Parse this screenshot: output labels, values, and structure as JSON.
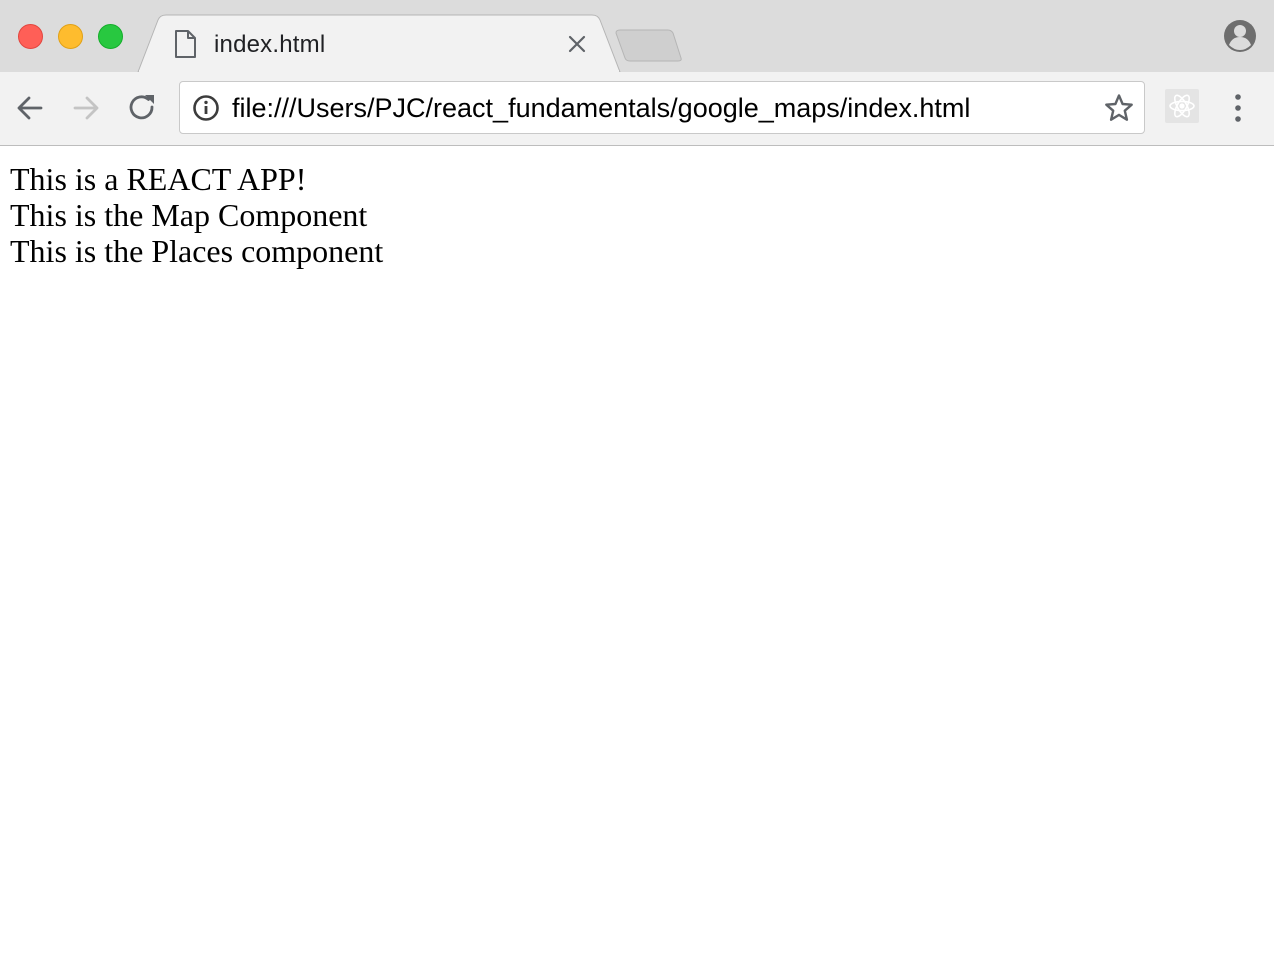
{
  "window": {
    "controls": [
      "close",
      "minimize",
      "maximize"
    ]
  },
  "tabs": [
    {
      "title": "index.html",
      "icon": "document-icon",
      "active": true
    }
  ],
  "toolbar": {
    "url": "file:///Users/PJC/react_fundamentals/google_maps/index.html",
    "icons": [
      "back-arrow-icon",
      "forward-arrow-icon",
      "reload-icon",
      "info-icon",
      "star-icon",
      "react-devtools-icon",
      "more-vert-icon",
      "profile-icon"
    ]
  },
  "page": {
    "lines": [
      "This is a REACT APP!",
      "This is the Map Component",
      "This is the Places component"
    ]
  },
  "colors": {
    "close": "#ff5f57",
    "minimize": "#febc2e",
    "maximize": "#28c840",
    "tabstrip": "#dcdcdc",
    "toolbar": "#f2f2f2"
  }
}
